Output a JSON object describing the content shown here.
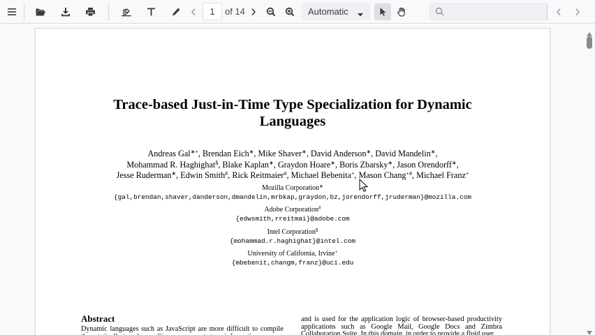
{
  "toolbar": {
    "page_number": "1",
    "page_count": "of 14",
    "zoom_value": "Automatic",
    "search_placeholder": ""
  },
  "icons": [
    "sidebar-toggle-icon",
    "open-file-icon",
    "download-icon",
    "print-icon",
    "draw-icon",
    "text-icon",
    "pencil-icon",
    "chevron-left-icon",
    "chevron-right-icon",
    "zoom-out-icon",
    "zoom-in-icon",
    "chevron-down-icon",
    "select-cursor-icon",
    "hand-tool-icon",
    "search-icon"
  ],
  "colors": {
    "toolbar_bg": "#f9f9fb",
    "active_tool_bg": "#dedee3",
    "viewer_bg": "#f9f9fb",
    "scroll_thumb": "#8a8a8e"
  },
  "document": {
    "title_line1": "Trace-based Just-in-Time Type Specialization for Dynamic",
    "title_line2": "Languages",
    "authors": [
      {
        "name": "Andreas Gal",
        "mark": "∗+"
      },
      {
        "name": "Brendan Eich",
        "mark": "∗"
      },
      {
        "name": "Mike Shaver",
        "mark": "∗"
      },
      {
        "name": "David Anderson",
        "mark": "∗"
      },
      {
        "name": "David Mandelin",
        "mark": "∗"
      },
      {
        "name": "Mohammad R. Haghighat",
        "mark": "$"
      },
      {
        "name": "Blake Kaplan",
        "mark": "∗"
      },
      {
        "name": "Graydon Hoare",
        "mark": "∗"
      },
      {
        "name": "Boris Zbarsky",
        "mark": "∗"
      },
      {
        "name": "Jason Orendorff",
        "mark": "∗"
      },
      {
        "name": "Jesse Ruderman",
        "mark": "∗"
      },
      {
        "name": "Edwin Smith",
        "mark": "#"
      },
      {
        "name": "Rick Reitmaier",
        "mark": "#"
      },
      {
        "name": "Michael Bebenita",
        "mark": "+"
      },
      {
        "name": "Mason Chang",
        "mark": "+#"
      },
      {
        "name": "Michael Franz",
        "mark": "+"
      }
    ],
    "affiliations": [
      {
        "name": "Mozilla Corporation",
        "mark": "∗",
        "emails": "{gal,brendan,shaver,danderson,dmandelin,mrbkap,graydon,bz,jorendorff,jruderman}@mozilla.com"
      },
      {
        "name": "Adobe Corporation",
        "mark": "#",
        "emails": "{edwsmith,rreitmai}@adobe.com"
      },
      {
        "name": "Intel Corporation",
        "mark": "$",
        "emails": "{mohammad.r.haghighat}@intel.com"
      },
      {
        "name": "University of California, Irvine",
        "mark": "+",
        "emails": "{mbebenit,changm,franz}@uci.edu"
      }
    ],
    "abstract_heading": "Abstract",
    "abstract_left": "Dynamic languages such as JavaScript are more difficult to compile than statically typed ones. Since no concrete type information",
    "abstract_right": "and is used for the application logic of browser-based productivity applications such as Google Mail, Google Docs and Zimbra Collaboration Suite. In this domain, in order to provide a fluid user"
  }
}
